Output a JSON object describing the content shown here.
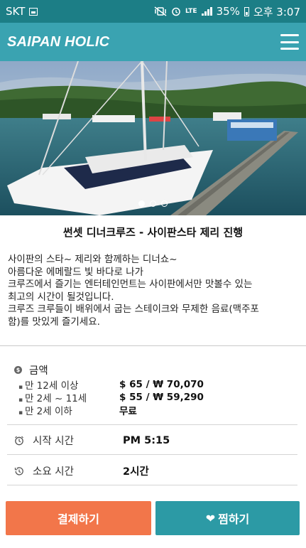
{
  "status_bar": {
    "carrier": "SKT",
    "network": "LTE",
    "battery_percent": "35%",
    "time": "오후 3:07",
    "icons": [
      "image-icon",
      "mute-vibrate-icon",
      "alarm-icon",
      "signal-icon",
      "battery-icon"
    ]
  },
  "header": {
    "brand": "SAIPAN HOLIC",
    "menu_icon": "hamburger-menu-icon",
    "color": "#3aa3b1"
  },
  "hero": {
    "description": "photo carousel",
    "slide_count": 3,
    "active_slide": 1
  },
  "product": {
    "title": "썬셋 디너크루즈 - 사이판스타 제리 진행",
    "description_lines": [
      "사이판의 스타~ 제리와 함께하는 디너쇼~",
      "아름다운 에메랄드 빛 바다로 나가",
      "크루즈에서 즐기는 엔터테인먼트는 사이판에서만 맛볼수 있는",
      "최고의 시간이 될것입니다.",
      "크루즈 크루들이 배위에서 굽는 스테이크와 무제한 음료(맥주포",
      "함)를 맛있게 즐기세요."
    ]
  },
  "pricing": {
    "label": "금액",
    "icon": "money-icon",
    "rows": [
      {
        "label": "만 12세 이상",
        "value": "$ 65 / ₩ 70,070"
      },
      {
        "label": "만 2세 ~ 11세",
        "value": "$ 55 / ₩ 59,290"
      },
      {
        "label": "만 2세 이하",
        "value": "무료"
      }
    ]
  },
  "start_time": {
    "label": "시작 시간",
    "value": "PM 5:15",
    "icon": "alarm-clock-icon"
  },
  "duration": {
    "label": "소요 시간",
    "value": "2시간",
    "icon": "history-icon"
  },
  "buttons": {
    "pay": "결제하기",
    "like": "찜하기",
    "pay_color": "#f2764a",
    "like_color": "#2c9aa5"
  }
}
